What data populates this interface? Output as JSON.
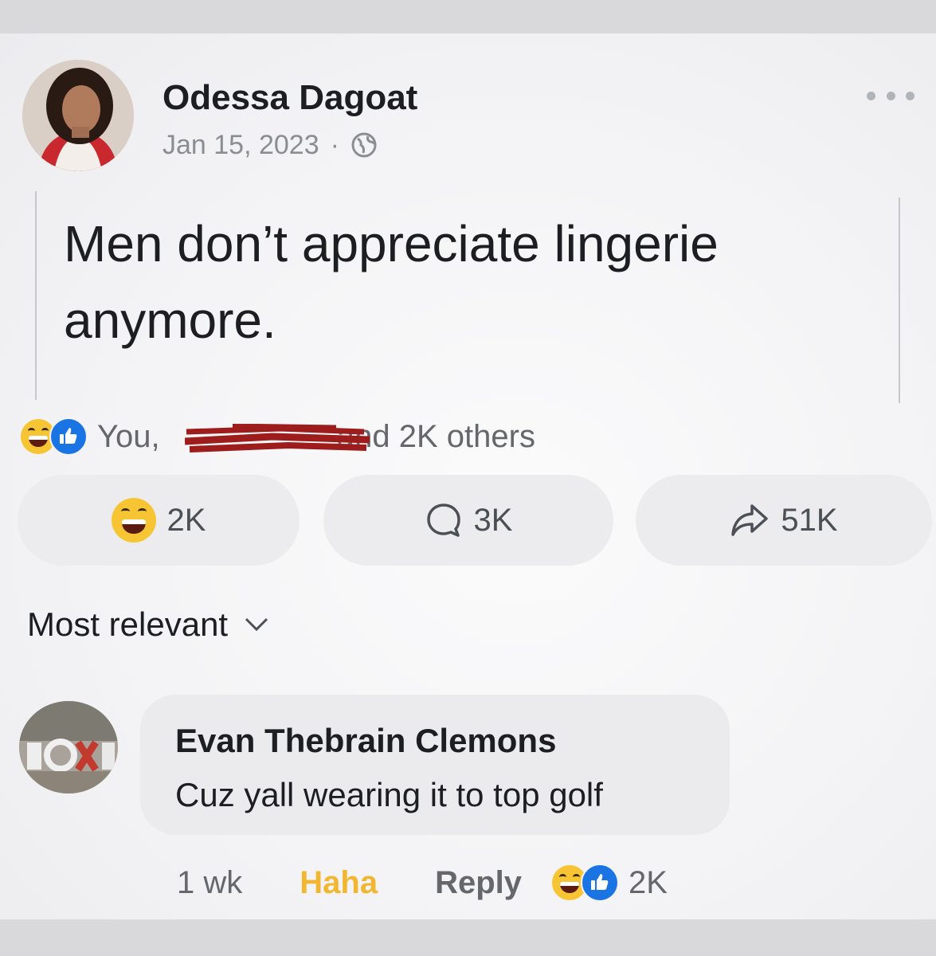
{
  "post": {
    "author": "Odessa Dagoat",
    "date": "Jan 15, 2023",
    "separator": "·",
    "privacy_icon": "globe-icon",
    "text": "Men don’t appreciate lingerie anymore."
  },
  "reactions_summary": {
    "text_you": "You,",
    "text_rest": "and 2K others"
  },
  "actions": {
    "react_count": "2K",
    "comment_count": "3K",
    "share_count": "51K"
  },
  "sort": {
    "label": "Most relevant"
  },
  "comment": {
    "author": "Evan Thebrain Clemons",
    "text": "Cuz yall wearing it to top golf",
    "time": "1 wk",
    "haha_label": "Haha",
    "reply_label": "Reply",
    "reaction_count": "2K"
  },
  "colors": {
    "haha": "#f2b630",
    "like_blue": "#1b74e4",
    "muted": "#65676b"
  }
}
